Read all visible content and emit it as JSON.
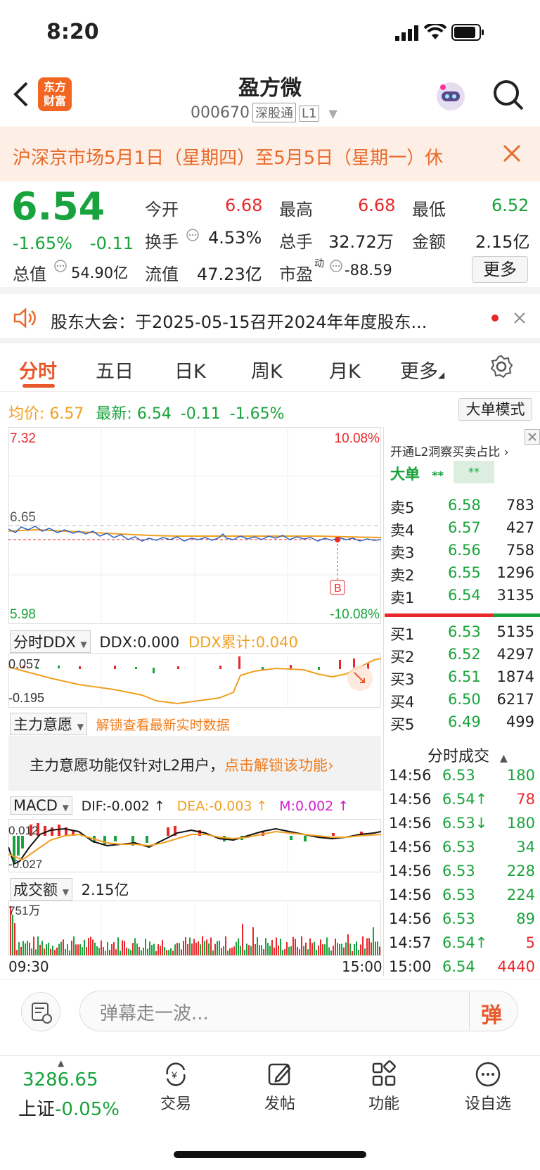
{
  "status": {
    "time": "8:20"
  },
  "header": {
    "title": "盈方微",
    "code": "000670",
    "tag1": "深股通",
    "tag2": "L1"
  },
  "banner": {
    "text": "沪深京市场5月1日（星期四）至5月5日（星期一）休"
  },
  "quote": {
    "price": "6.54",
    "change_pct": "-1.65%",
    "change": "-0.11",
    "open_label": "今开",
    "open": "6.68",
    "high_label": "最高",
    "high": "6.68",
    "low_label": "最低",
    "low": "6.52",
    "turnover_label": "换手",
    "turnover": "4.53%",
    "volume_label": "总手",
    "volume": "32.72万",
    "amount_label": "金额",
    "amount": "2.15亿",
    "mcap_label": "总值",
    "mcap": "54.90亿",
    "float_label": "流值",
    "float": "47.23亿",
    "pe_label": "市盈",
    "pe_sup": "动",
    "pe": "-88.59",
    "more": "更多"
  },
  "notice": {
    "text": "股东大会：于2025-05-15召开2024年年度股东..."
  },
  "tabs": [
    "分时",
    "五日",
    "日K",
    "周K",
    "月K",
    "更多"
  ],
  "infoline": {
    "avg_label": "均价:",
    "avg": "6.57",
    "latest_label": "最新:",
    "latest": "6.54",
    "chg": "-0.11",
    "pct": "-1.65%",
    "mode_btn": "大单模式"
  },
  "chart_labels": {
    "ymax": "7.32",
    "ymid": "6.65",
    "ymin": "5.98",
    "pmax": "10.08%",
    "pmin": "-10.08%",
    "marker": "B"
  },
  "ddx": {
    "selector": "分时DDX",
    "ddx": "DDX:0.000",
    "ddx_cum": "DDX累计:0.040",
    "top": "0.057",
    "bottom": "-0.195"
  },
  "zlyy": {
    "selector": "主力意愿",
    "unlock": "解锁查看最新实时数据",
    "notice_pre": "主力意愿功能仅针对L2用户，",
    "notice_link": "点击解锁该功能"
  },
  "macd": {
    "selector": "MACD",
    "dif": "DIF:-0.002 ↑",
    "dea": "DEA:-0.003 ↑",
    "m": "M:0.002 ↑",
    "top": "0.012",
    "bottom": "-0.027"
  },
  "vol": {
    "selector": "成交额",
    "total": "2.15亿",
    "max": "751万",
    "start": "09:30",
    "end": "15:00"
  },
  "orderbook": {
    "l2_text": "开通L2洞察买卖占比",
    "big_label": "大单",
    "big_v1": "**",
    "big_v2": "**",
    "asks": [
      {
        "label": "卖5",
        "price": "6.58",
        "vol": "783"
      },
      {
        "label": "卖4",
        "price": "6.57",
        "vol": "427"
      },
      {
        "label": "卖3",
        "price": "6.56",
        "vol": "758"
      },
      {
        "label": "卖2",
        "price": "6.55",
        "vol": "1296"
      },
      {
        "label": "卖1",
        "price": "6.54",
        "vol": "3135"
      }
    ],
    "bids": [
      {
        "label": "买1",
        "price": "6.53",
        "vol": "5135"
      },
      {
        "label": "买2",
        "price": "6.52",
        "vol": "4297"
      },
      {
        "label": "买3",
        "price": "6.51",
        "vol": "1874"
      },
      {
        "label": "买4",
        "price": "6.50",
        "vol": "6217"
      },
      {
        "label": "买5",
        "price": "6.49",
        "vol": "499"
      }
    ]
  },
  "ticks": {
    "title": "分时成交",
    "rows": [
      {
        "time": "14:56",
        "price": "6.53",
        "vol": "180",
        "pc": "green",
        "vc": "green"
      },
      {
        "time": "14:56",
        "price": "6.54↑",
        "vol": "78",
        "pc": "green",
        "vc": "red"
      },
      {
        "time": "14:56",
        "price": "6.53↓",
        "vol": "180",
        "pc": "green",
        "vc": "green"
      },
      {
        "time": "14:56",
        "price": "6.53",
        "vol": "34",
        "pc": "green",
        "vc": "green"
      },
      {
        "time": "14:56",
        "price": "6.53",
        "vol": "228",
        "pc": "green",
        "vc": "green"
      },
      {
        "time": "14:56",
        "price": "6.53",
        "vol": "224",
        "pc": "green",
        "vc": "green"
      },
      {
        "time": "14:56",
        "price": "6.53",
        "vol": "89",
        "pc": "green",
        "vc": "green"
      },
      {
        "time": "14:57",
        "price": "6.54↑",
        "vol": "5",
        "pc": "green",
        "vc": "red"
      },
      {
        "time": "15:00",
        "price": "6.54",
        "vol": "4440",
        "pc": "green",
        "vc": "red"
      }
    ]
  },
  "danmu": {
    "placeholder": "弹幕走一波...",
    "btn": "弹"
  },
  "bottom": {
    "index_value": "3286.65",
    "index_name": "上证",
    "index_pct": "-0.05%",
    "items": [
      "交易",
      "发帖",
      "功能",
      "设自选"
    ]
  },
  "colors": {
    "up": "#e8282b",
    "down": "#19a33c",
    "accent": "#e8582b",
    "avg": "#f0a020"
  }
}
